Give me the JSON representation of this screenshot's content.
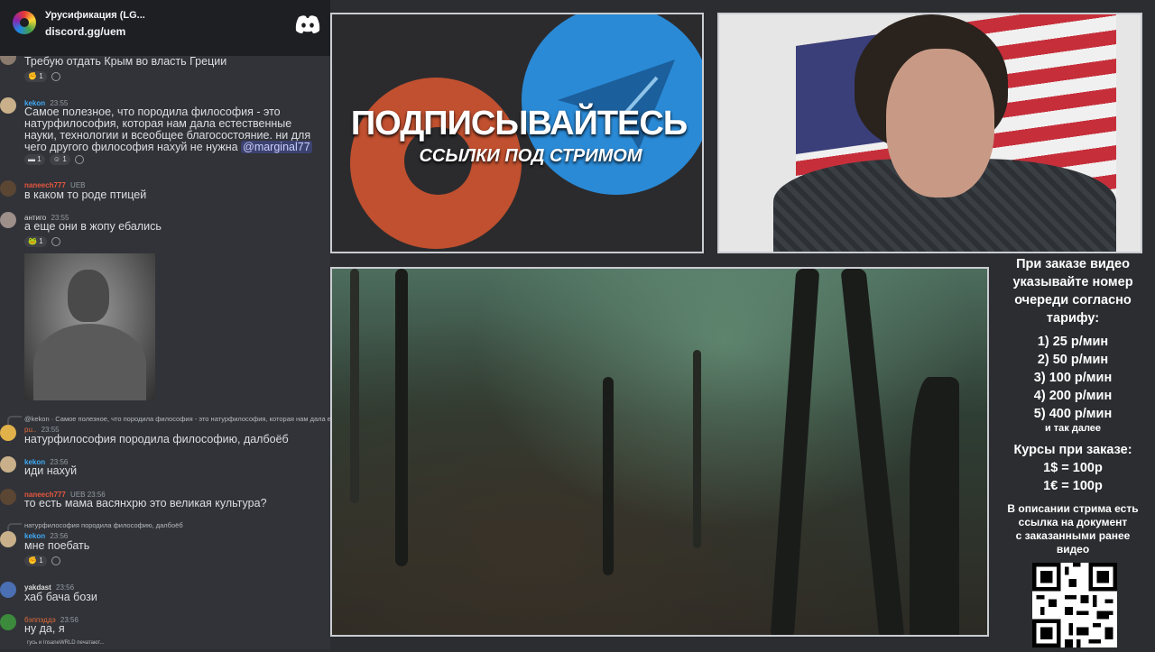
{
  "server": {
    "name": "Урусификация (LG...",
    "invite": "discord.gg/uem",
    "discord_icon": "discord-logo-icon"
  },
  "messages": [
    {
      "text": "Требую отдать Крым во власть Греции",
      "reactions": [
        "1"
      ]
    },
    {
      "user": "kekon",
      "time": "23:55",
      "lines": [
        "Самое полезное, что породила философия - это",
        "натурфилософия, которая нам дала естественные",
        "науки, технологии и всеобщее благосостояние. ни для",
        "чего другого философия нахуй не нужна"
      ],
      "mention": "@marginal77",
      "reactions": [
        "1",
        "1"
      ]
    },
    {
      "user": "naneech777",
      "tags": "UEB",
      "time": "23:55",
      "text": "в каком то роде птицей"
    },
    {
      "user": "антиго",
      "time": "23:55",
      "text": "а еще они в жопу ебались",
      "reactions": [
        "1"
      ]
    },
    {
      "reply_preview": "@kekon · Самое полезное, что породила философия - это натурфилософия, которая нам дала е",
      "user": "pu..",
      "time": "23:55",
      "text": "натурфилософия породила философию, далбоёб"
    },
    {
      "user": "kekon",
      "time": "23:56",
      "text": "иди нахуй"
    },
    {
      "user": "naneech777",
      "tags": "UEB",
      "time": "23:56",
      "text": "то есть мама васянхрю это великая культура?"
    },
    {
      "reply_preview": "натурфилософия породила философию, далбоёб",
      "user": "kekon",
      "time": "23:56",
      "text": "мне поебать",
      "reactions": [
        "1"
      ]
    },
    {
      "user": "yakdast",
      "time": "23:56",
      "text": "хаб бача бози"
    },
    {
      "user": "бэппэддэ",
      "time": "23:56",
      "text": "ну да, я"
    }
  ],
  "typing": "гусь и InsaneWRLD печатают...",
  "promo": {
    "title": "ПОДПИСЫВАЙТЕСЬ",
    "subtitle": "ССЫЛКИ ПОД СТРИМОМ"
  },
  "info": {
    "order_lines": [
      "При заказе видео",
      "указывайте номер",
      "очереди согласно",
      "тарифу:"
    ],
    "tariffs": [
      "1) 25 р/мин",
      "2) 50 р/мин",
      "3) 100 р/мин",
      "4) 200 р/мин",
      "5) 400 р/мин"
    ],
    "tariff_more": "и так далее",
    "rates_head": "Курсы при заказе:",
    "rates": [
      "1$ = 100р",
      "1€ = 100р"
    ],
    "desc_lines": [
      "В описании стрима есть",
      "ссылка на документ",
      "с заказанными ранее",
      "видео"
    ]
  }
}
